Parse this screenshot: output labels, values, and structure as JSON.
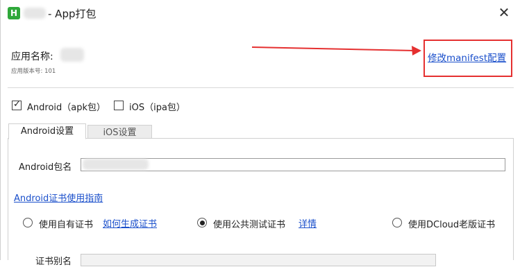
{
  "window": {
    "title": "- App打包",
    "app_icon_letter": "H"
  },
  "app_info": {
    "name_label": "应用名称:",
    "version_text": "应用版本号: 101"
  },
  "manifest_link": "修改manifest配置",
  "platforms": [
    {
      "label": "Android（apk包）",
      "checked": true
    },
    {
      "label": "iOS（ipa包）",
      "checked": false
    }
  ],
  "tabs": [
    {
      "label": "Android设置",
      "active": true
    },
    {
      "label": "iOS设置",
      "active": false
    }
  ],
  "android": {
    "package_label": "Android包名",
    "package_value": "",
    "cert_guide_link": "Android证书使用指南",
    "cert_options": [
      {
        "label": "使用自有证书",
        "link": "如何生成证书",
        "selected": false
      },
      {
        "label": "使用公共测试证书",
        "link": "详情",
        "selected": true
      },
      {
        "label": "使用DCloud老版证书",
        "link": "",
        "selected": false
      }
    ],
    "alias_label": "证书别名"
  },
  "colors": {
    "link": "#1a4fcb",
    "highlight": "#e53030",
    "icon_green": "#2fa83a"
  }
}
